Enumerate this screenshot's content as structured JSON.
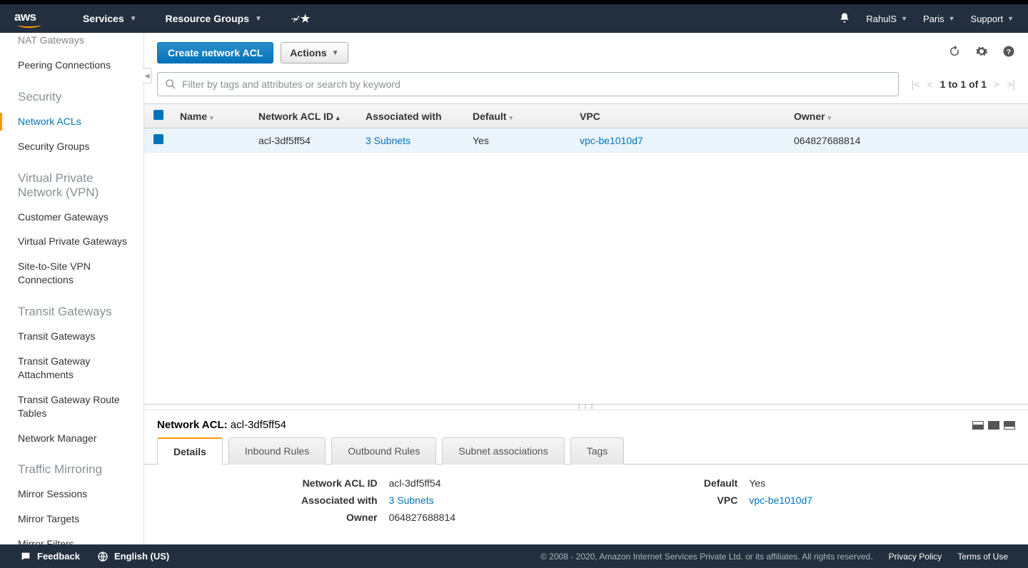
{
  "header": {
    "services": "Services",
    "resource_groups": "Resource Groups",
    "user": "RahulS",
    "region": "Paris",
    "support": "Support"
  },
  "sidebar": {
    "items_top": [
      "NAT Gateways",
      "Peering Connections"
    ],
    "sec_security": "Security",
    "security_items": [
      "Network ACLs",
      "Security Groups"
    ],
    "sec_vpn": "Virtual Private Network (VPN)",
    "vpn_items": [
      "Customer Gateways",
      "Virtual Private Gateways",
      "Site-to-Site VPN Connections"
    ],
    "sec_tgw": "Transit Gateways",
    "tgw_items": [
      "Transit Gateways",
      "Transit Gateway Attachments",
      "Transit Gateway Route Tables",
      "Network Manager"
    ],
    "sec_mirror": "Traffic Mirroring",
    "mirror_items": [
      "Mirror Sessions",
      "Mirror Targets",
      "Mirror Filters"
    ]
  },
  "toolbar": {
    "create": "Create network ACL",
    "actions": "Actions"
  },
  "search": {
    "placeholder": "Filter by tags and attributes or search by keyword"
  },
  "pagination": {
    "text": "1 to 1 of 1"
  },
  "table": {
    "cols": {
      "name": "Name",
      "aclid": "Network ACL ID",
      "assoc": "Associated with",
      "default": "Default",
      "vpc": "VPC",
      "owner": "Owner"
    },
    "row": {
      "name": "",
      "aclid": "acl-3df5ff54",
      "assoc": "3 Subnets",
      "default": "Yes",
      "vpc": "vpc-be1010d7",
      "owner": "064827688814"
    }
  },
  "detail": {
    "title_label": "Network ACL:",
    "title_value": "acl-3df5ff54",
    "tabs": {
      "details": "Details",
      "inbound": "Inbound Rules",
      "outbound": "Outbound Rules",
      "subnet": "Subnet associations",
      "tags": "Tags"
    },
    "left": {
      "aclid_lbl": "Network ACL ID",
      "aclid_val": "acl-3df5ff54",
      "assoc_lbl": "Associated with",
      "assoc_val": "3 Subnets",
      "owner_lbl": "Owner",
      "owner_val": "064827688814"
    },
    "right": {
      "default_lbl": "Default",
      "default_val": "Yes",
      "vpc_lbl": "VPC",
      "vpc_val": "vpc-be1010d7"
    }
  },
  "footer": {
    "feedback": "Feedback",
    "language": "English (US)",
    "copyright": "© 2008 - 2020, Amazon Internet Services Private Ltd. or its affiliates. All rights reserved.",
    "privacy": "Privacy Policy",
    "terms": "Terms of Use"
  }
}
